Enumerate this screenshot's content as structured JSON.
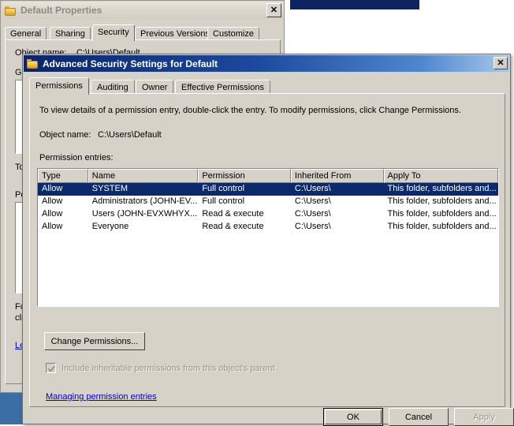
{
  "desktop": {
    "taskbar_color": "#0d2460",
    "sidebar_color": "#3a6ea5"
  },
  "properties_window": {
    "title": "Default Properties",
    "close_label": "✕",
    "folder_icon": "folder-icon",
    "tabs": [
      {
        "label": "General",
        "active": false
      },
      {
        "label": "Sharing",
        "active": false
      },
      {
        "label": "Security",
        "active": true
      },
      {
        "label": "Previous Versions",
        "active": false
      },
      {
        "label": "Customize",
        "active": false
      }
    ],
    "obscured_labels": {
      "object_name": "Object name:",
      "object_value": "C:\\Users\\Default",
      "group_or_user": "Group or user names:",
      "to_change": "To change permissions, click Edit.",
      "permissions_for": "Permissions for SYSTEM",
      "for_special": "For special permissions or advanced settings,",
      "click_advanced": "click Advanced.",
      "learn_link": "Learn about access control and permissions"
    }
  },
  "advanced_dialog": {
    "title": "Advanced Security Settings for Default",
    "close_label": "✕",
    "folder_icon": "folder-icon",
    "tabs": [
      {
        "label": "Permissions",
        "active": true
      },
      {
        "label": "Auditing",
        "active": false
      },
      {
        "label": "Owner",
        "active": false
      },
      {
        "label": "Effective Permissions",
        "active": false
      }
    ],
    "instruction": "To view details of a permission entry, double-click the entry. To modify permissions, click Change Permissions.",
    "object_name_label": "Object name:",
    "object_name_value": "C:\\Users\\Default",
    "permission_entries_label": "Permission entries:",
    "table": {
      "columns": [
        "Type",
        "Name",
        "Permission",
        "Inherited From",
        "Apply To"
      ],
      "rows": [
        {
          "type": "Allow",
          "name": "SYSTEM",
          "permission": "Full control",
          "inherited_from": "C:\\Users\\",
          "apply_to": "This folder, subfolders and...",
          "selected": true
        },
        {
          "type": "Allow",
          "name": "Administrators (JOHN-EV...",
          "permission": "Full control",
          "inherited_from": "C:\\Users\\",
          "apply_to": "This folder, subfolders and...",
          "selected": false
        },
        {
          "type": "Allow",
          "name": "Users (JOHN-EVXWHYX...",
          "permission": "Read & execute",
          "inherited_from": "C:\\Users\\",
          "apply_to": "This folder, subfolders and...",
          "selected": false
        },
        {
          "type": "Allow",
          "name": "Everyone",
          "permission": "Read & execute",
          "inherited_from": "C:\\Users\\",
          "apply_to": "This folder, subfolders and...",
          "selected": false
        }
      ]
    },
    "change_permissions_label": "Change Permissions...",
    "inherit_checkbox": {
      "label": "Include inheritable permissions from this object's parent",
      "checked": true,
      "disabled": true
    },
    "managing_link": "Managing permission entries",
    "buttons": {
      "ok": "OK",
      "cancel": "Cancel",
      "apply": "Apply"
    },
    "selection_color": "#0b2a6b"
  }
}
